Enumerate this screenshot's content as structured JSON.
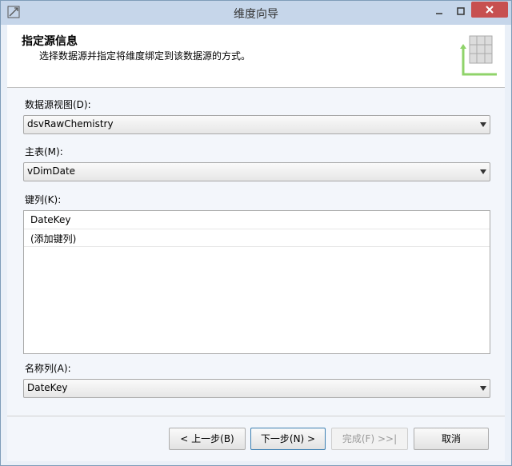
{
  "window": {
    "title": "维度向导"
  },
  "header": {
    "title": "指定源信息",
    "subtitle": "选择数据源并指定将维度绑定到该数据源的方式。"
  },
  "form": {
    "dsv_label": "数据源视图(D):",
    "dsv_value": "dsvRawChemistry",
    "main_table_label": "主表(M):",
    "main_table_value": "vDimDate",
    "key_columns_label": "键列(K):",
    "key_columns": [
      "DateKey",
      "(添加键列)"
    ],
    "name_column_label": "名称列(A):",
    "name_column_value": "DateKey"
  },
  "footer": {
    "back_label": "< 上一步(B)",
    "next_label": "下一步(N) >",
    "finish_label": "完成(F) >>|",
    "cancel_label": "取消"
  },
  "colors": {
    "close_button": "#c75050",
    "titlebar": "#c6d6ea",
    "accent": "#3c7fb1"
  }
}
